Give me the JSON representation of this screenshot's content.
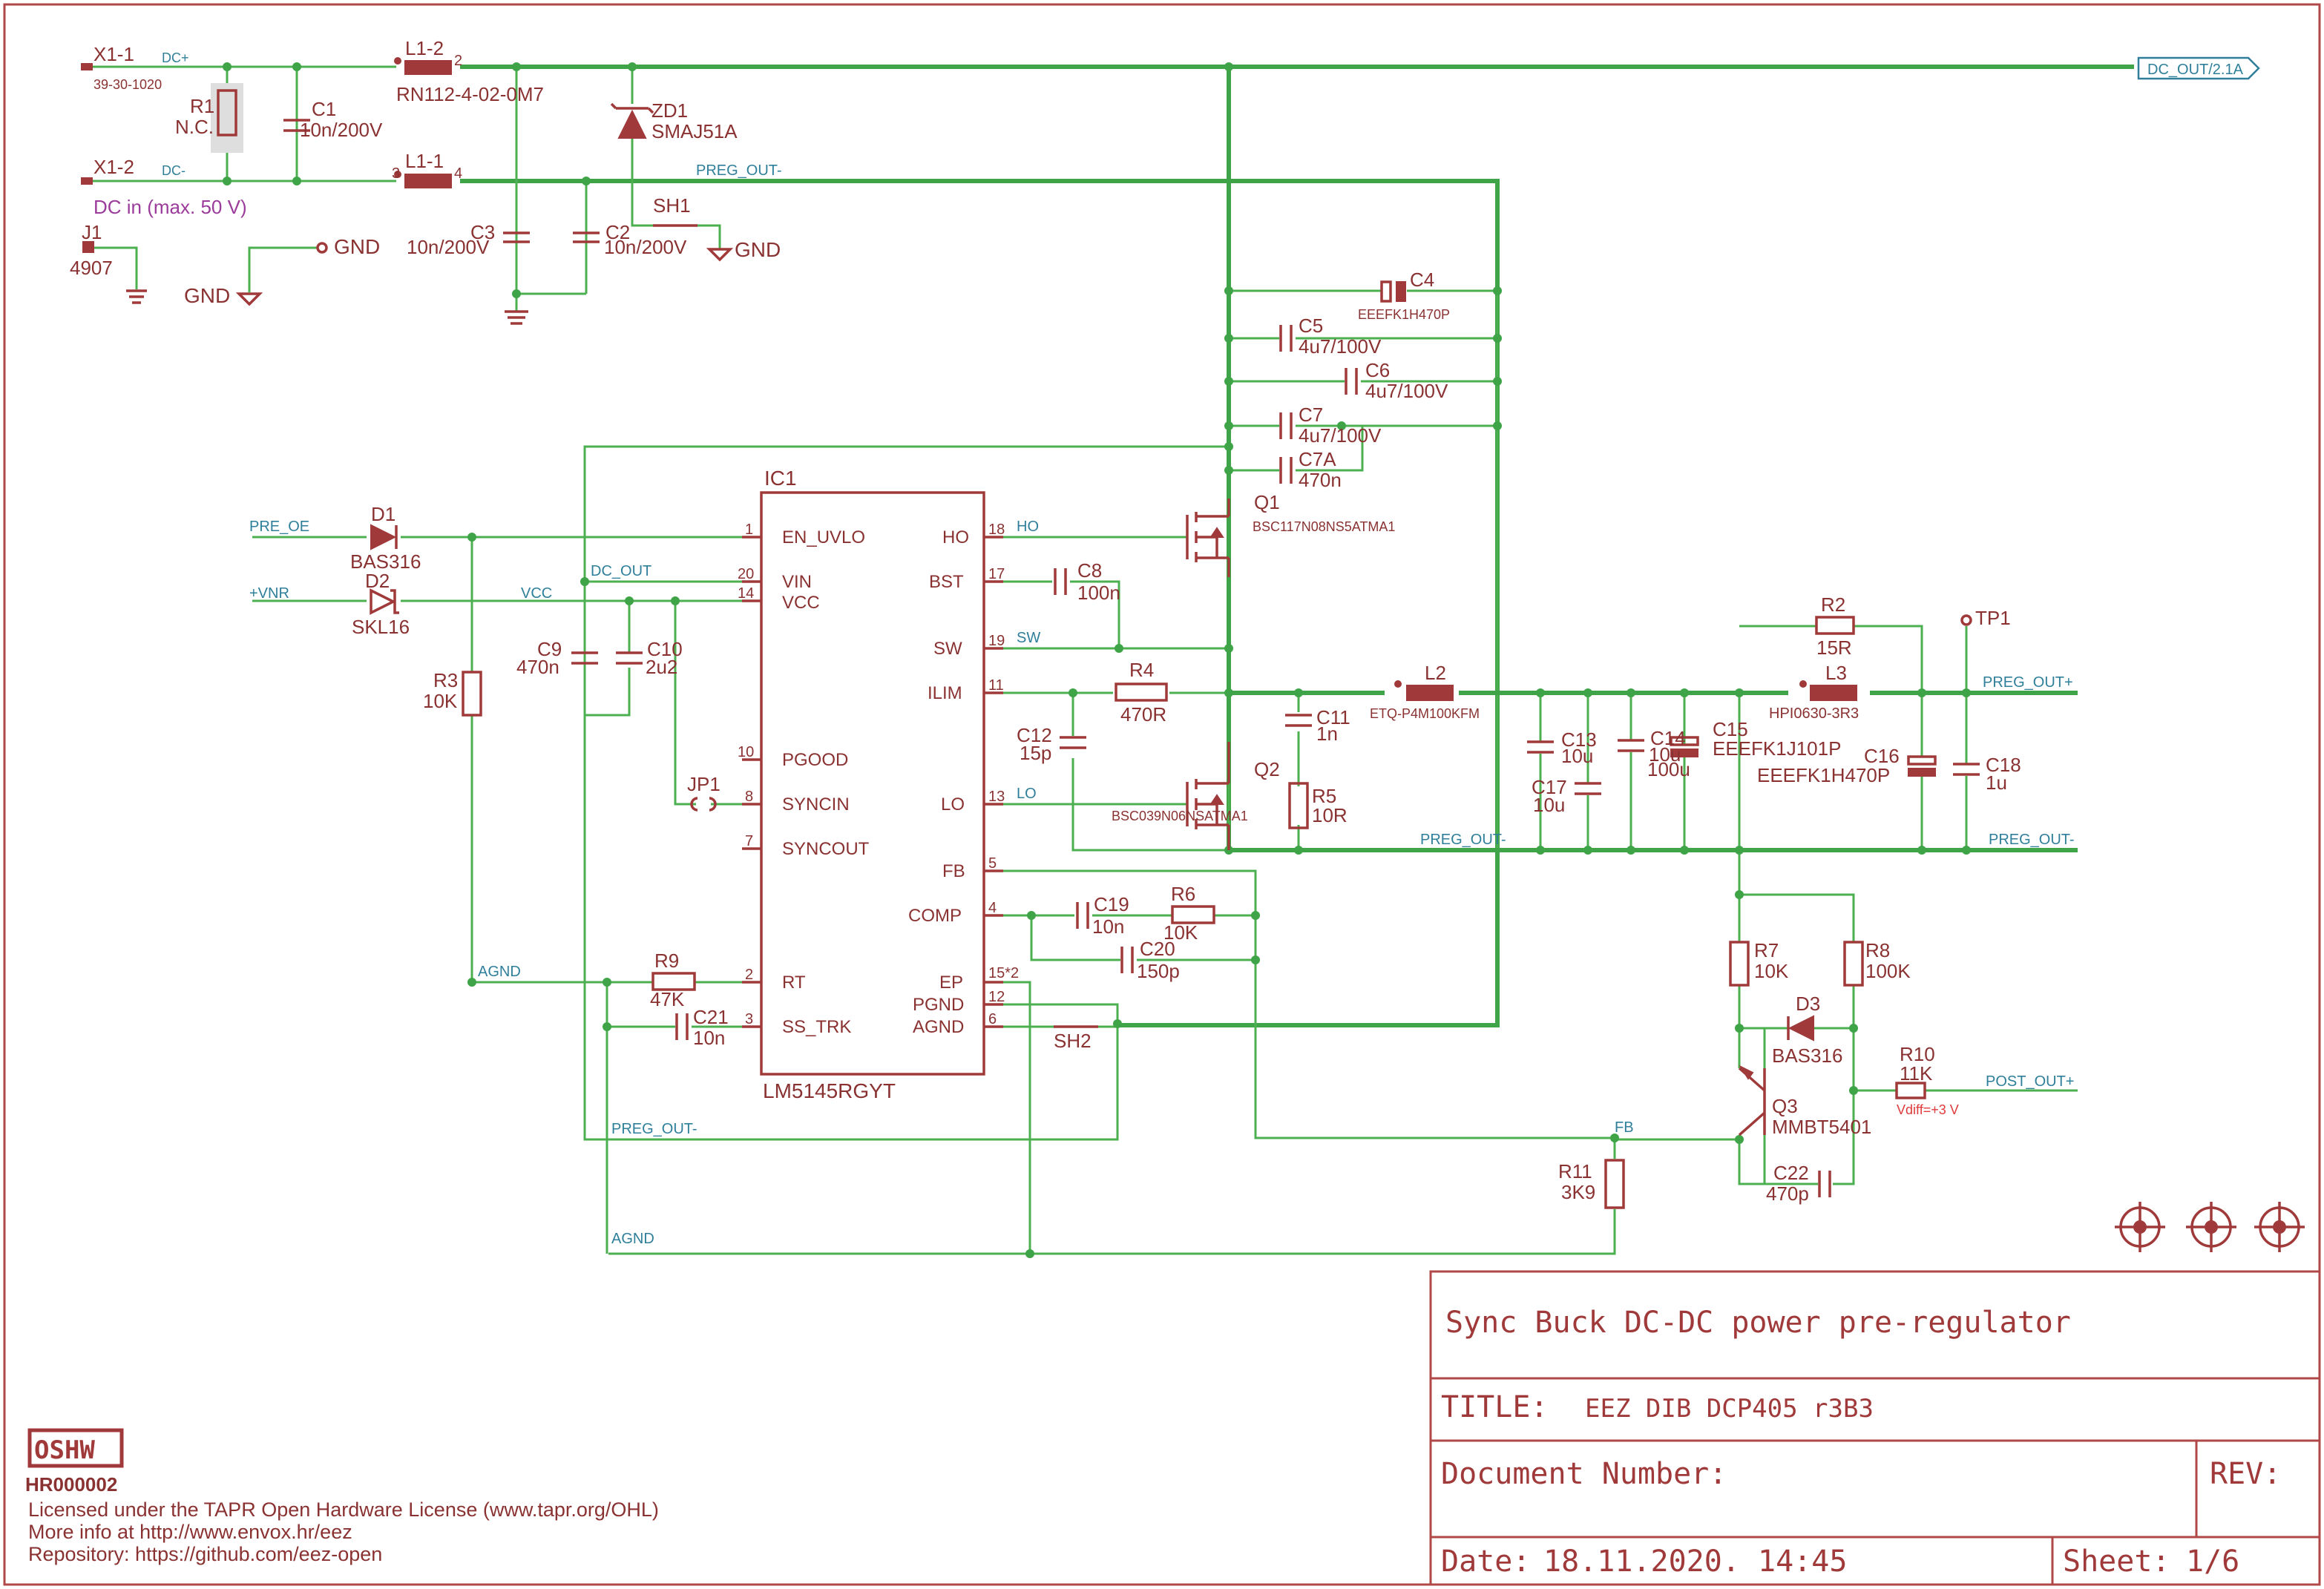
{
  "connector": {
    "x1_1": "X1-1",
    "x1_2": "X1-2",
    "x1_part": "39-30-1020",
    "dc_plus": "DC+",
    "dc_minus": "DC-",
    "dc_in_note": "DC in (max. 50 V)",
    "j1": "J1",
    "j1_value": "4907"
  },
  "nets": {
    "gnd": "GND",
    "dc_out_port": "DC_OUT/2.1A",
    "preg_out_minus": "PREG_OUT-",
    "preg_out_plus": "PREG_OUT+",
    "pre_oe": "PRE_OE",
    "vnr": "+VNR",
    "dc_out": "DC_OUT",
    "vcc": "VCC",
    "ho": "HO",
    "sw": "SW",
    "lo": "LO",
    "agnd": "AGND",
    "fb": "FB",
    "post_out_plus": "POST_OUT+",
    "vdiff": "Vdiff=+3 V"
  },
  "components": {
    "r1": "R1",
    "r1_val": "N.C.",
    "c1": "C1",
    "c1_val": "10n/200V",
    "l1_2": "L1-2",
    "l1_2_pin": "2",
    "l1_1": "L1-1",
    "l1_1_pin3": "3",
    "l1_1_pin4": "4",
    "l1_val": "RN112-4-02-0M7",
    "zd1": "ZD1",
    "zd1_val": "SMAJ51A",
    "sh1": "SH1",
    "c3": "C3",
    "c3_val": "10n/200V",
    "c2": "C2",
    "c2_val": "10n/200V",
    "c4": "C4",
    "c4_val": "EEEFK1H470P",
    "c5": "C5",
    "c5_val": "4u7/100V",
    "c6": "C6",
    "c6_val": "4u7/100V",
    "c7": "C7",
    "c7_val": "4u7/100V",
    "c7a": "C7A",
    "c7a_val": "470n",
    "q1": "Q1",
    "q1_val": "BSC117N08NS5ATMA1",
    "q2": "Q2",
    "q2_val": "BSC039N06NSATMA1",
    "c8": "C8",
    "c8_val": "100n",
    "r4": "R4",
    "r4_val": "470R",
    "c11": "C11",
    "c11_val": "1n",
    "r5": "R5",
    "r5_val": "10R",
    "l2": "L2",
    "l2_val": "ETQ-P4M100KFM",
    "c12": "C12",
    "c12_val": "15p",
    "c13": "C13",
    "c13_val": "10u",
    "c14": "C14",
    "c14_val": "10u",
    "c15": "C15",
    "c15_val": "EEEFK1J101P",
    "c15_b": "100u",
    "c17": "C17",
    "c17_val": "10u",
    "r2": "R2",
    "r2_val": "15R",
    "tp1": "TP1",
    "l3": "L3",
    "l3_val": "HPI0630-3R3",
    "c16": "C16",
    "c16_val": "EEEFK1H470P",
    "c18": "C18",
    "c18_val": "1u",
    "d1": "D1",
    "d1_val": "BAS316",
    "d2": "D2",
    "d2_val": "SKL16",
    "r3": "R3",
    "r3_val": "10K",
    "c9": "C9",
    "c9_val": "470n",
    "c10": "C10",
    "c10_val": "2u2",
    "jp1": "JP1",
    "c19": "C19",
    "c19_val": "10n",
    "r6": "R6",
    "r6_val": "10K",
    "c20": "C20",
    "c20_val": "150p",
    "r9": "R9",
    "r9_val": "47K",
    "c21": "C21",
    "c21_val": "10n",
    "sh2": "SH2",
    "r11": "R11",
    "r11_val": "3K9",
    "r7": "R7",
    "r7_val": "10K",
    "r8": "R8",
    "r8_val": "100K",
    "d3": "D3",
    "d3_val": "BAS316",
    "r10": "R10",
    "r10_val": "11K",
    "q3": "Q3",
    "q3_val": "MMBT5401",
    "c22": "C22",
    "c22_val": "470p"
  },
  "ic1": {
    "ref": "IC1",
    "part": "LM5145RGYT",
    "left_pins": [
      {
        "num": "1",
        "name": "EN_UVLO"
      },
      {
        "num": "20",
        "name": "VIN"
      },
      {
        "num": "14",
        "name": "VCC"
      },
      {
        "num": "10",
        "name": "PGOOD"
      },
      {
        "num": "8",
        "name": "SYNCIN"
      },
      {
        "num": "7",
        "name": "SYNCOUT"
      },
      {
        "num": "2",
        "name": "RT"
      },
      {
        "num": "3",
        "name": "SS_TRK"
      }
    ],
    "right_pins": [
      {
        "num": "18",
        "name": "HO"
      },
      {
        "num": "17",
        "name": "BST"
      },
      {
        "num": "19",
        "name": "SW"
      },
      {
        "num": "11",
        "name": "ILIM"
      },
      {
        "num": "13",
        "name": "LO"
      },
      {
        "num": "5",
        "name": "FB"
      },
      {
        "num": "4",
        "name": "COMP"
      },
      {
        "num": "15*2",
        "name": "EP"
      },
      {
        "num": "12",
        "name": "PGND"
      },
      {
        "num": "6",
        "name": "AGND"
      }
    ]
  },
  "license": {
    "logo": "OSHW",
    "cert": "HR000002",
    "line1": "Licensed under the TAPR Open Hardware License (www.tapr.org/OHL)",
    "line2": "More info at http://www.envox.hr/eez",
    "line3": "Repository: https://github.com/eez-open"
  },
  "title_block": {
    "description": "Sync Buck DC-DC power pre-regulator",
    "title_label": "TITLE:",
    "title_value": "EEZ DIB DCP405 r3B3",
    "doc_number_label": "Document Number:",
    "rev_label": "REV:",
    "date_label": "Date:",
    "date_value": "18.11.2020. 14:45",
    "sheet_label": "Sheet:",
    "sheet_value": "1/6"
  },
  "colors": {
    "frame": "#b04848",
    "wire": "#4caf50",
    "symbol": "#a03a3a",
    "net_label": "#2f7f9a",
    "note": "#9b3b9b"
  }
}
